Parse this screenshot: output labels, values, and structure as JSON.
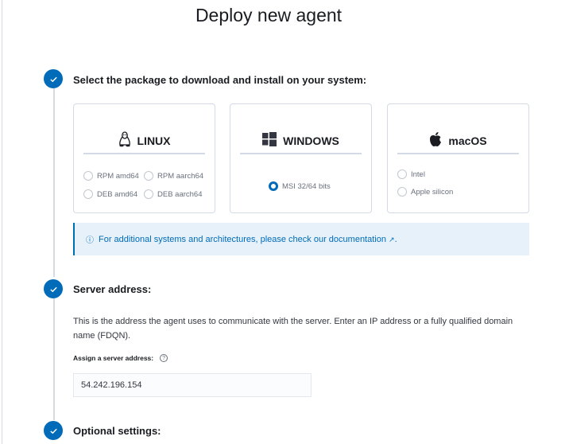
{
  "page": {
    "title": "Deploy new agent"
  },
  "steps": [
    {
      "title": "Select the package to download and install on your system:"
    },
    {
      "title": "Server address:"
    },
    {
      "title": "Optional settings:"
    }
  ],
  "packages": {
    "linux": {
      "label": "LINUX",
      "options": [
        "RPM amd64",
        "RPM aarch64",
        "DEB amd64",
        "DEB aarch64"
      ]
    },
    "windows": {
      "label": "WINDOWS",
      "options": [
        "MSI 32/64 bits"
      ],
      "selected": "MSI 32/64 bits"
    },
    "macos": {
      "label": "macOS",
      "options": [
        "Intel",
        "Apple silicon"
      ]
    }
  },
  "callout": {
    "text": "For additional systems and architectures, please check our documentation",
    "suffix": "."
  },
  "server": {
    "description": "This is the address the agent uses to communicate with the server. Enter an IP address or a fully qualified domain name (FDQN).",
    "label": "Assign a server address:",
    "value": "54.242.196.154"
  },
  "colors": {
    "accent": "#006bb8",
    "callout_bg": "#e6f1fa"
  }
}
